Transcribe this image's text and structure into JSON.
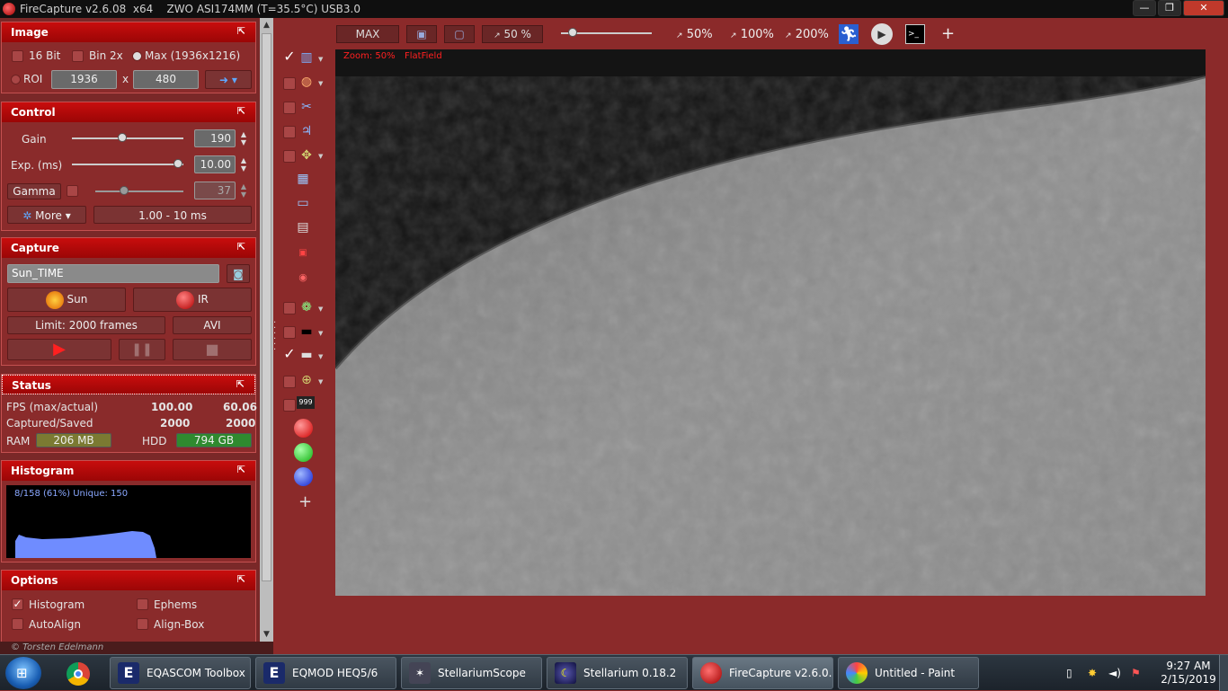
{
  "window": {
    "title": "FireCapture v2.6.08  x64    ZWO ASI174MM (T=35.5°C) USB3.0",
    "min": "—",
    "max": "❐",
    "close": "✕"
  },
  "image_panel": {
    "title": "Image",
    "collapse": "⇱",
    "bit16": "16 Bit",
    "bin2x": "Bin 2x",
    "max_label": "Max (1936x1216)",
    "roi": "ROI",
    "roi_w": "1936",
    "x": "x",
    "roi_h": "480",
    "arrow": "➜"
  },
  "control_panel": {
    "title": "Control",
    "gain_label": "Gain",
    "gain_value": "190",
    "gain_level": 0.45,
    "exp_label": "Exp. (ms)",
    "exp_value": "10.00",
    "exp_level": 0.95,
    "gamma_label": "Gamma",
    "gamma_value": "37",
    "gamma_level": 0.33,
    "more_label": "More",
    "range": "1.00 - 10 ms"
  },
  "capture_panel": {
    "title": "Capture",
    "profile": "Sun_TIME",
    "sun": "Sun",
    "ir": "IR",
    "limit": "Limit: 2000 frames",
    "format": "AVI"
  },
  "status_panel": {
    "title": "Status",
    "fps_label": "FPS (max/actual)",
    "fps_max": "100.00",
    "fps_actual": "60.06",
    "cs_label": "Captured/Saved",
    "captured": "2000",
    "saved": "2000",
    "ram_label": "RAM",
    "ram": "206 MB",
    "hdd_label": "HDD",
    "hdd": "794 GB"
  },
  "histogram_panel": {
    "title": "Histogram",
    "info": "8/158 (61%)  Unique: 150"
  },
  "options_panel": {
    "title": "Options",
    "histogram": "Histogram",
    "ephems": "Ephems",
    "autoalign": "AutoAlign",
    "alignbox": "Align-Box"
  },
  "credit": "© Torsten Edelmann",
  "toolbar": {
    "max": "MAX",
    "zoom_value": "50 %",
    "z50": "50%",
    "z100": "100%",
    "z200": "200%",
    "plus": "+"
  },
  "viewer": {
    "zoom_label": "Zoom: 50%",
    "flat_label": "FlatField"
  },
  "tools": {
    "plus": "+",
    "counter": "999"
  },
  "taskbar": {
    "items": [
      "EQASCOM Toolbox",
      "EQMOD HEQ5/6",
      "StellariumScope",
      "Stellarium 0.18.2",
      "FireCapture v2.6.0...",
      "Untitled - Paint"
    ],
    "time": "9:27 AM",
    "date": "2/15/2019"
  },
  "colors": {
    "accent": "#c80d0d",
    "panel": "#8a2b2b",
    "background": "#8b2a2a"
  }
}
